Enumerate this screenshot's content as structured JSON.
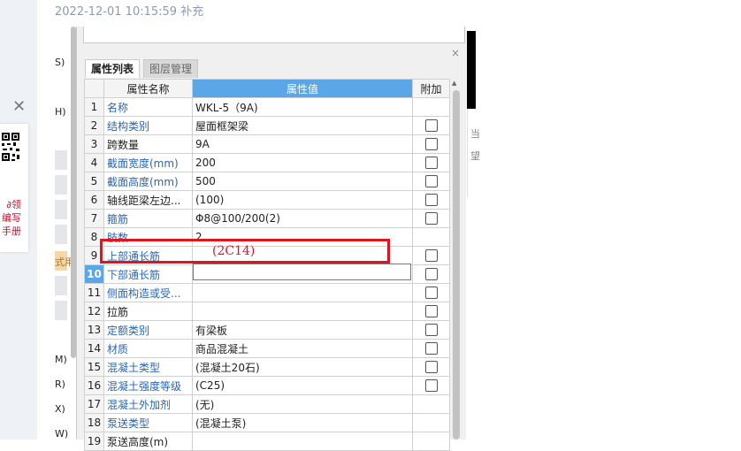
{
  "header": {
    "timestamp": "2022-12-01 10:15:59 补充"
  },
  "sidebar": {
    "close_symbol": "✕",
    "promo_lines": [
      "∂领",
      "编写",
      "手册"
    ],
    "labels": [
      {
        "text": "S)"
      },
      {
        "text": "H)"
      },
      {
        "text": "式用"
      },
      {
        "text": "M)"
      },
      {
        "text": "R)"
      },
      {
        "text": "X)"
      },
      {
        "text": "W)"
      }
    ]
  },
  "panel": {
    "close_symbol": "×",
    "tabs": [
      {
        "label": "属性列表",
        "active": true
      },
      {
        "label": "图层管理",
        "active": false
      }
    ],
    "columns": {
      "index": "",
      "name": "属性名称",
      "value": "属性值",
      "attach": "附加"
    },
    "rows": [
      {
        "num": "1",
        "name": "名称",
        "value": "WKL-5（9A)",
        "name_color": "blue",
        "checkbox": false
      },
      {
        "num": "2",
        "name": "结构类别",
        "value": "屋面框架梁",
        "name_color": "blue",
        "checkbox": true
      },
      {
        "num": "3",
        "name": "跨数量",
        "value": "9A",
        "name_color": "dark",
        "checkbox": true
      },
      {
        "num": "4",
        "name": "截面宽度(mm)",
        "value": "200",
        "name_color": "blue",
        "checkbox": true
      },
      {
        "num": "5",
        "name": "截面高度(mm)",
        "value": "500",
        "name_color": "blue",
        "checkbox": true
      },
      {
        "num": "6",
        "name": "轴线距梁左边...",
        "value": "(100)",
        "name_color": "dark",
        "checkbox": true
      },
      {
        "num": "7",
        "name": "箍筋",
        "value": "Φ8@100/200(2)",
        "name_color": "blue",
        "checkbox": true
      },
      {
        "num": "8",
        "name": "肢数",
        "value": "2",
        "name_color": "blue",
        "checkbox": false
      },
      {
        "num": "9",
        "name": "上部通长筋",
        "value": "",
        "name_color": "blue",
        "checkbox": true
      },
      {
        "num": "10",
        "name": "下部通长筋",
        "value": "",
        "name_color": "blue",
        "checkbox": true,
        "selected": true
      },
      {
        "num": "11",
        "name": "侧面构造或受...",
        "value": "",
        "name_color": "blue",
        "checkbox": true
      },
      {
        "num": "12",
        "name": "拉筋",
        "value": "",
        "name_color": "dark",
        "checkbox": true
      },
      {
        "num": "13",
        "name": "定额类别",
        "value": "有梁板",
        "name_color": "blue",
        "checkbox": true
      },
      {
        "num": "14",
        "name": "材质",
        "value": "商品混凝土",
        "name_color": "blue",
        "checkbox": true
      },
      {
        "num": "15",
        "name": "混凝土类型",
        "value": "(混凝土20石)",
        "name_color": "blue",
        "checkbox": true
      },
      {
        "num": "16",
        "name": "混凝土强度等级",
        "value": "(C25)",
        "name_color": "blue",
        "checkbox": true
      },
      {
        "num": "17",
        "name": "混凝土外加剂",
        "value": "(无)",
        "name_color": "blue",
        "checkbox": false
      },
      {
        "num": "18",
        "name": "泵送类型",
        "value": "(混凝土泵)",
        "name_color": "blue",
        "checkbox": false
      },
      {
        "num": "19",
        "name": "泵送高度(m)",
        "value": "",
        "name_color": "dark",
        "checkbox": false
      }
    ]
  },
  "annotation": {
    "text": "(2C14)",
    "color": "#e0141e"
  },
  "right_fragments": [
    "当",
    "望"
  ],
  "colors": {
    "header_blue": "#5aa6e6",
    "link_blue": "#2a65b7",
    "annotation_red": "#e0141e"
  }
}
